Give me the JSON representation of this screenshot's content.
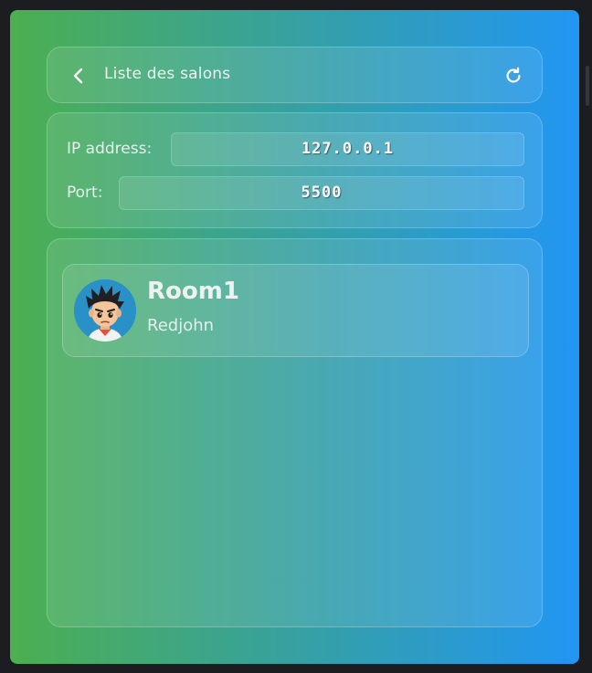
{
  "header": {
    "title": "Liste des salons",
    "back_icon": "chevron-left-icon",
    "refresh_icon": "refresh-icon"
  },
  "connection": {
    "ip_label": "IP address:",
    "ip_value": "127.0.0.1",
    "port_label": "Port:",
    "port_value": "5500"
  },
  "rooms": [
    {
      "name": "Room1",
      "owner": "Redjohn",
      "avatar_icon": "avatar-boy"
    }
  ],
  "colors": {
    "gradient_start": "#4caf50",
    "gradient_end": "#2196f3"
  }
}
